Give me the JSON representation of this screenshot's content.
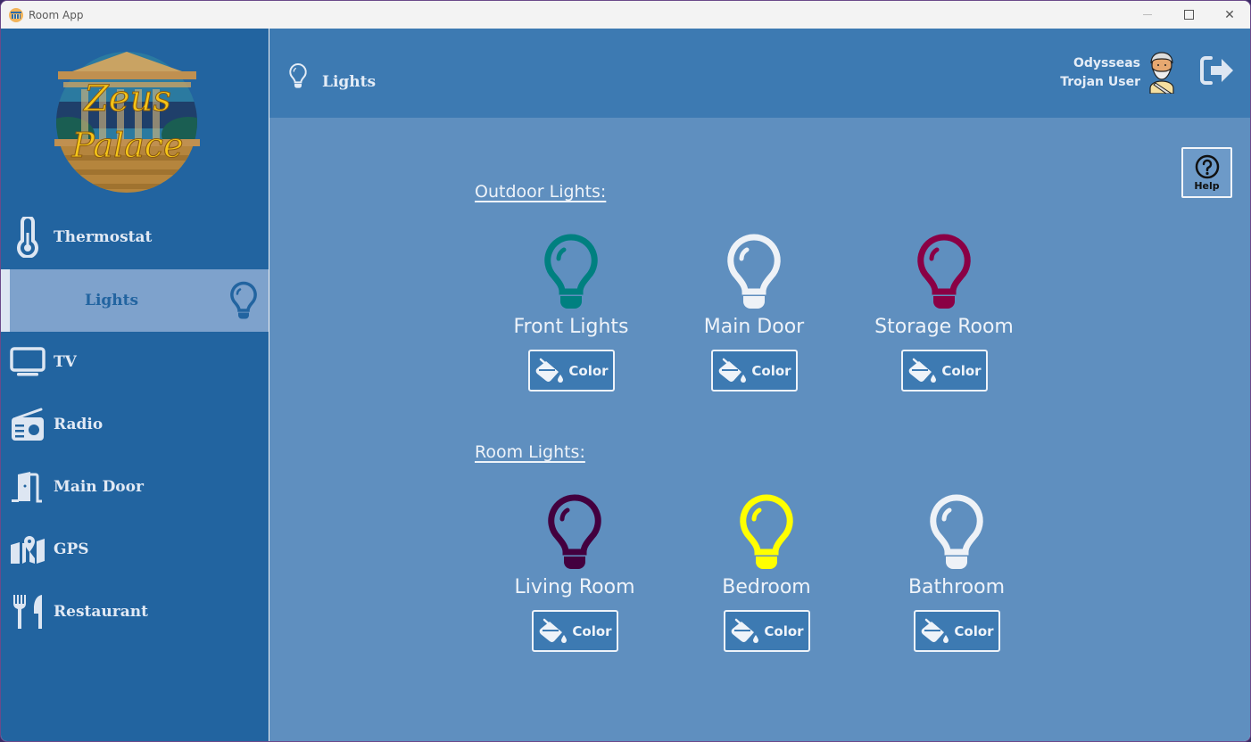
{
  "window": {
    "title": "Room App",
    "controls": {
      "minimize": "—",
      "maximize": "☐",
      "close": "✕"
    }
  },
  "sidebar": {
    "logo_text_line1": "Zeus",
    "logo_text_line2": "Palace",
    "items": [
      {
        "label": "Thermostat",
        "icon": "thermometer-icon",
        "active": false
      },
      {
        "label": "Lights",
        "icon": "lightbulb-icon",
        "active": true
      },
      {
        "label": "TV",
        "icon": "tv-icon",
        "active": false
      },
      {
        "label": "Radio",
        "icon": "radio-icon",
        "active": false
      },
      {
        "label": "Main Door",
        "icon": "door-icon",
        "active": false
      },
      {
        "label": "GPS",
        "icon": "map-icon",
        "active": false
      },
      {
        "label": "Restaurant",
        "icon": "utensils-icon",
        "active": false
      }
    ]
  },
  "header": {
    "title": "Lights",
    "user_name": "Odysseas",
    "user_role": "Trojan User"
  },
  "main": {
    "help_label": "Help",
    "sections": [
      {
        "title": "Outdoor Lights:",
        "lights": [
          {
            "name": "Front Lights",
            "color": "#008080",
            "button_label": "Color"
          },
          {
            "name": "Main Door",
            "color": "#eef2f7",
            "button_label": "Color"
          },
          {
            "name": "Storage Room",
            "color": "#8a0045",
            "button_label": "Color"
          }
        ]
      },
      {
        "title": "Room Lights:",
        "lights": [
          {
            "name": "Living Room",
            "color": "#43003f",
            "button_label": "Color"
          },
          {
            "name": "Bedroom",
            "color": "#ffff00",
            "button_label": "Color"
          },
          {
            "name": "Bathroom",
            "color": "#eef2f7",
            "button_label": "Color"
          }
        ]
      }
    ]
  },
  "colors": {
    "sidebar_bg": "#2264a0",
    "header_bg": "#3d7ab2",
    "main_bg": "#5f8fbf",
    "active_nav_bg": "#7ea2cc",
    "text_light": "#eef3f9"
  }
}
